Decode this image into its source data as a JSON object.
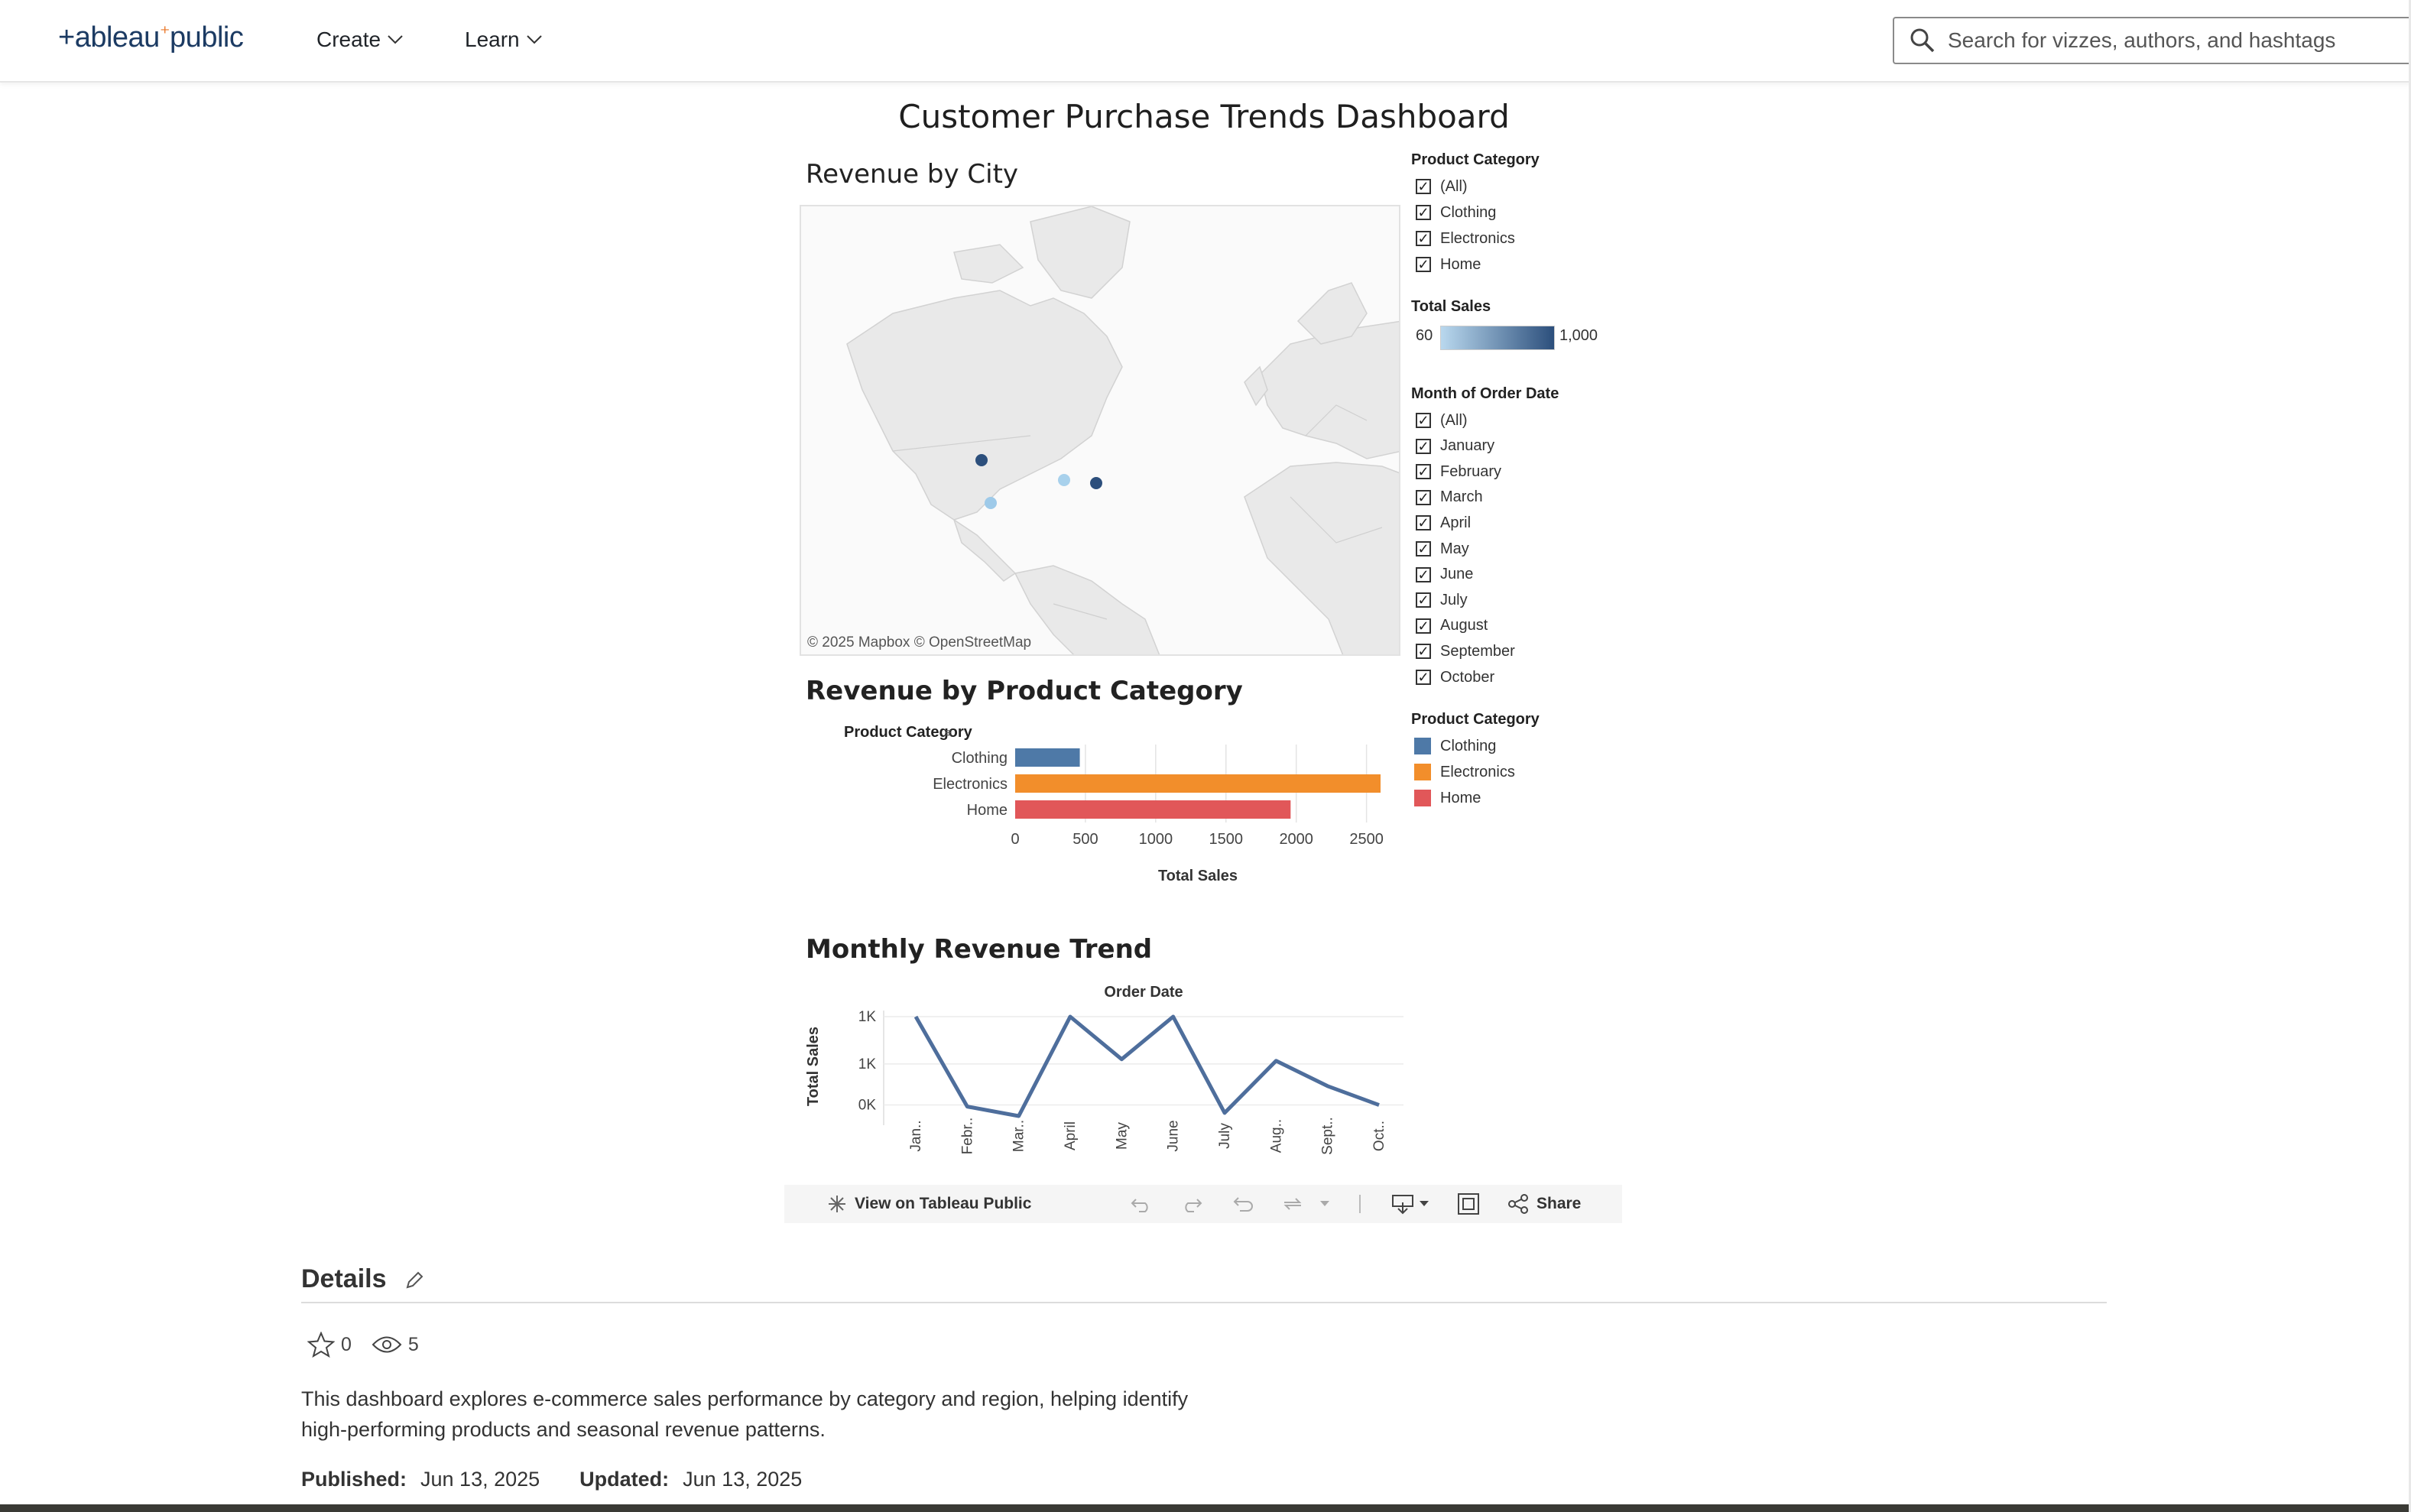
{
  "header": {
    "logo": {
      "text_left": "+ableau",
      "text_right": "public"
    },
    "menus": [
      {
        "label": "Create"
      },
      {
        "label": "Learn"
      }
    ],
    "search": {
      "placeholder": "Search for vizzes, authors, and hashtags"
    }
  },
  "dashboard": {
    "title": "Customer Purchase Trends Dashboard",
    "map": {
      "title": "Revenue by City",
      "credit": "© 2025 Mapbox  © OpenStreetMap",
      "points_colors": [
        "#2c4f7c",
        "#9ecae9",
        "#a8d1ec",
        "#2c4f7c"
      ]
    },
    "bar_section_title": "Revenue by Product Category",
    "line_section_title": "Monthly Revenue Trend",
    "filters": {
      "product_category": {
        "title": "Product Category",
        "options": [
          "(All)",
          "Clothing",
          "Electronics",
          "Home"
        ]
      },
      "total_sales": {
        "title": "Total Sales",
        "min": "60",
        "max": "1,000"
      },
      "month": {
        "title": "Month of Order Date",
        "options": [
          "(All)",
          "January",
          "February",
          "March",
          "April",
          "May",
          "June",
          "July",
          "August",
          "September",
          "October"
        ]
      },
      "color_legend": {
        "title": "Product Category",
        "items": [
          {
            "label": "Clothing",
            "color": "#4e79a7"
          },
          {
            "label": "Electronics",
            "color": "#f28e2b"
          },
          {
            "label": "Home",
            "color": "#e15759"
          }
        ]
      }
    },
    "toolbar": {
      "view_label": "View on Tableau Public",
      "share_label": "Share"
    }
  },
  "chart_data": [
    {
      "type": "bar",
      "orientation": "horizontal",
      "row_header": "Product Category",
      "categories": [
        "Clothing",
        "Electronics",
        "Home"
      ],
      "values": [
        460,
        2600,
        1960
      ],
      "colors": [
        "#4e79a7",
        "#f28e2b",
        "#e15759"
      ],
      "xlabel": "Total Sales",
      "xticks": [
        "0",
        "500",
        "1000",
        "1500",
        "2000",
        "2500"
      ],
      "xlim": [
        0,
        2600
      ],
      "grid": true
    },
    {
      "type": "line",
      "title": "Order Date",
      "ylabel": "Total Sales",
      "x": [
        "Jan..",
        "Febr..",
        "Mar..",
        "April",
        "May",
        "June",
        "July",
        "Aug..",
        "Sept..",
        "Oct.."
      ],
      "values": [
        1000,
        430,
        370,
        1000,
        730,
        1000,
        390,
        720,
        560,
        440
      ],
      "ytick_labels": [
        "1K",
        "1K",
        "0K"
      ],
      "ytick_values": [
        1000,
        700,
        440
      ],
      "color": "#4e6e9c",
      "grid": true
    }
  ],
  "details": {
    "title": "Details",
    "favorites": "0",
    "views": "5",
    "description": "This dashboard explores e-commerce sales performance by category and region, helping identify high-performing products and seasonal revenue patterns.",
    "published_label": "Published:",
    "published_value": "Jun 13, 2025",
    "updated_label": "Updated:",
    "updated_value": "Jun 13, 2025"
  }
}
